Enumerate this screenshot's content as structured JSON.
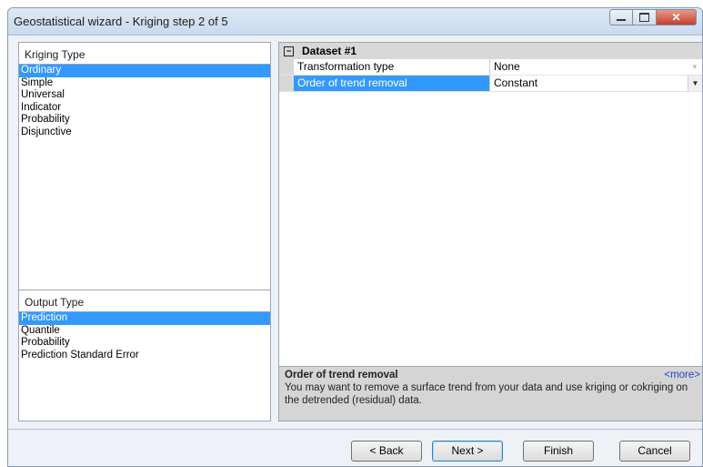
{
  "window": {
    "title": "Geostatistical wizard - Kriging step 2 of 5",
    "buttons": [
      "minimize-icon",
      "maximize-icon",
      "close-icon"
    ]
  },
  "kriging_type": {
    "header": "Kriging Type",
    "items": [
      "Ordinary",
      "Simple",
      "Universal",
      "Indicator",
      "Probability",
      "Disjunctive"
    ],
    "selected": "Ordinary"
  },
  "output_type": {
    "header": "Output Type",
    "items": [
      "Prediction",
      "Quantile",
      "Probability",
      "Prediction Standard Error"
    ],
    "selected": "Prediction"
  },
  "property_grid": {
    "category": "Dataset #1",
    "collapse_symbol": "−",
    "rows": [
      {
        "name": "Transformation type",
        "value": "None"
      },
      {
        "name": "Order of trend removal",
        "value": "Constant"
      }
    ]
  },
  "description": {
    "title": "Order of trend removal",
    "more_link": "<more>",
    "body": "You may want to remove a surface trend from your data and use kriging or cokriging on the detrended (residual) data."
  },
  "footer": {
    "back": "< Back",
    "next": "Next >",
    "finish": "Finish",
    "cancel": "Cancel"
  },
  "colors": {
    "selection": "#3399ff",
    "category_bg": "#d8d8d8",
    "window_bg": "#eef1f6"
  }
}
